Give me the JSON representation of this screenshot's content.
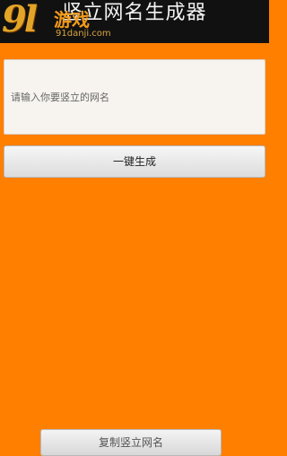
{
  "app": {
    "title": "竖立网名生成器"
  },
  "watermark": {
    "logo": "9l",
    "game": "游戏",
    "domain": "91danji.com"
  },
  "input": {
    "placeholder": "请输入你要竖立的网名"
  },
  "buttons": {
    "generate_label": "一键生成",
    "copy_label": "复制竖立网名"
  },
  "colors": {
    "background": "#ff7f00",
    "titlebar": "#111111",
    "watermark": "#f5b22a"
  }
}
